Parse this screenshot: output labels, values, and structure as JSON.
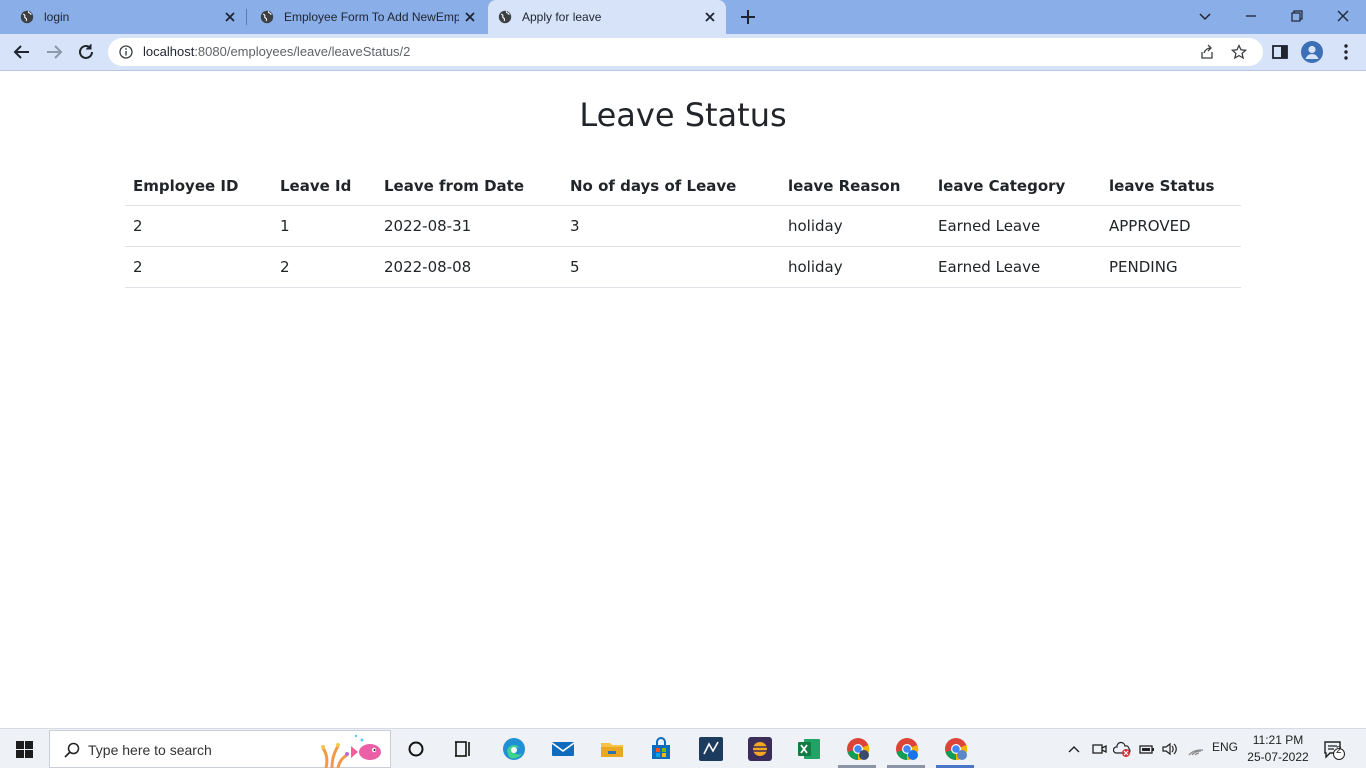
{
  "browser": {
    "tabs": [
      {
        "title": "login",
        "active": false
      },
      {
        "title": "Employee Form To Add NewEmp",
        "active": false
      },
      {
        "title": "Apply for leave",
        "active": true
      }
    ],
    "url_host": "localhost",
    "url_rest": ":8080/employees/leave/leaveStatus/2"
  },
  "page": {
    "title": "Leave Status",
    "table": {
      "headers": [
        "Employee ID",
        "Leave Id",
        "Leave from Date",
        "No of days of Leave",
        "leave Reason",
        "leave Category",
        "leave Status"
      ],
      "rows": [
        [
          "2",
          "1",
          "2022-08-31",
          "3",
          "holiday",
          "Earned Leave",
          "APPROVED"
        ],
        [
          "2",
          "2",
          "2022-08-08",
          "5",
          "holiday",
          "Earned Leave",
          "PENDING"
        ]
      ]
    }
  },
  "taskbar": {
    "search_placeholder": "Type here to search",
    "language": "ENG",
    "time": "11:21 PM",
    "date": "25-07-2022",
    "notification_count": "2"
  },
  "colors": {
    "tabstrip": "#8aaee8",
    "toolbar": "#d6e3f8",
    "text": "#212529"
  }
}
